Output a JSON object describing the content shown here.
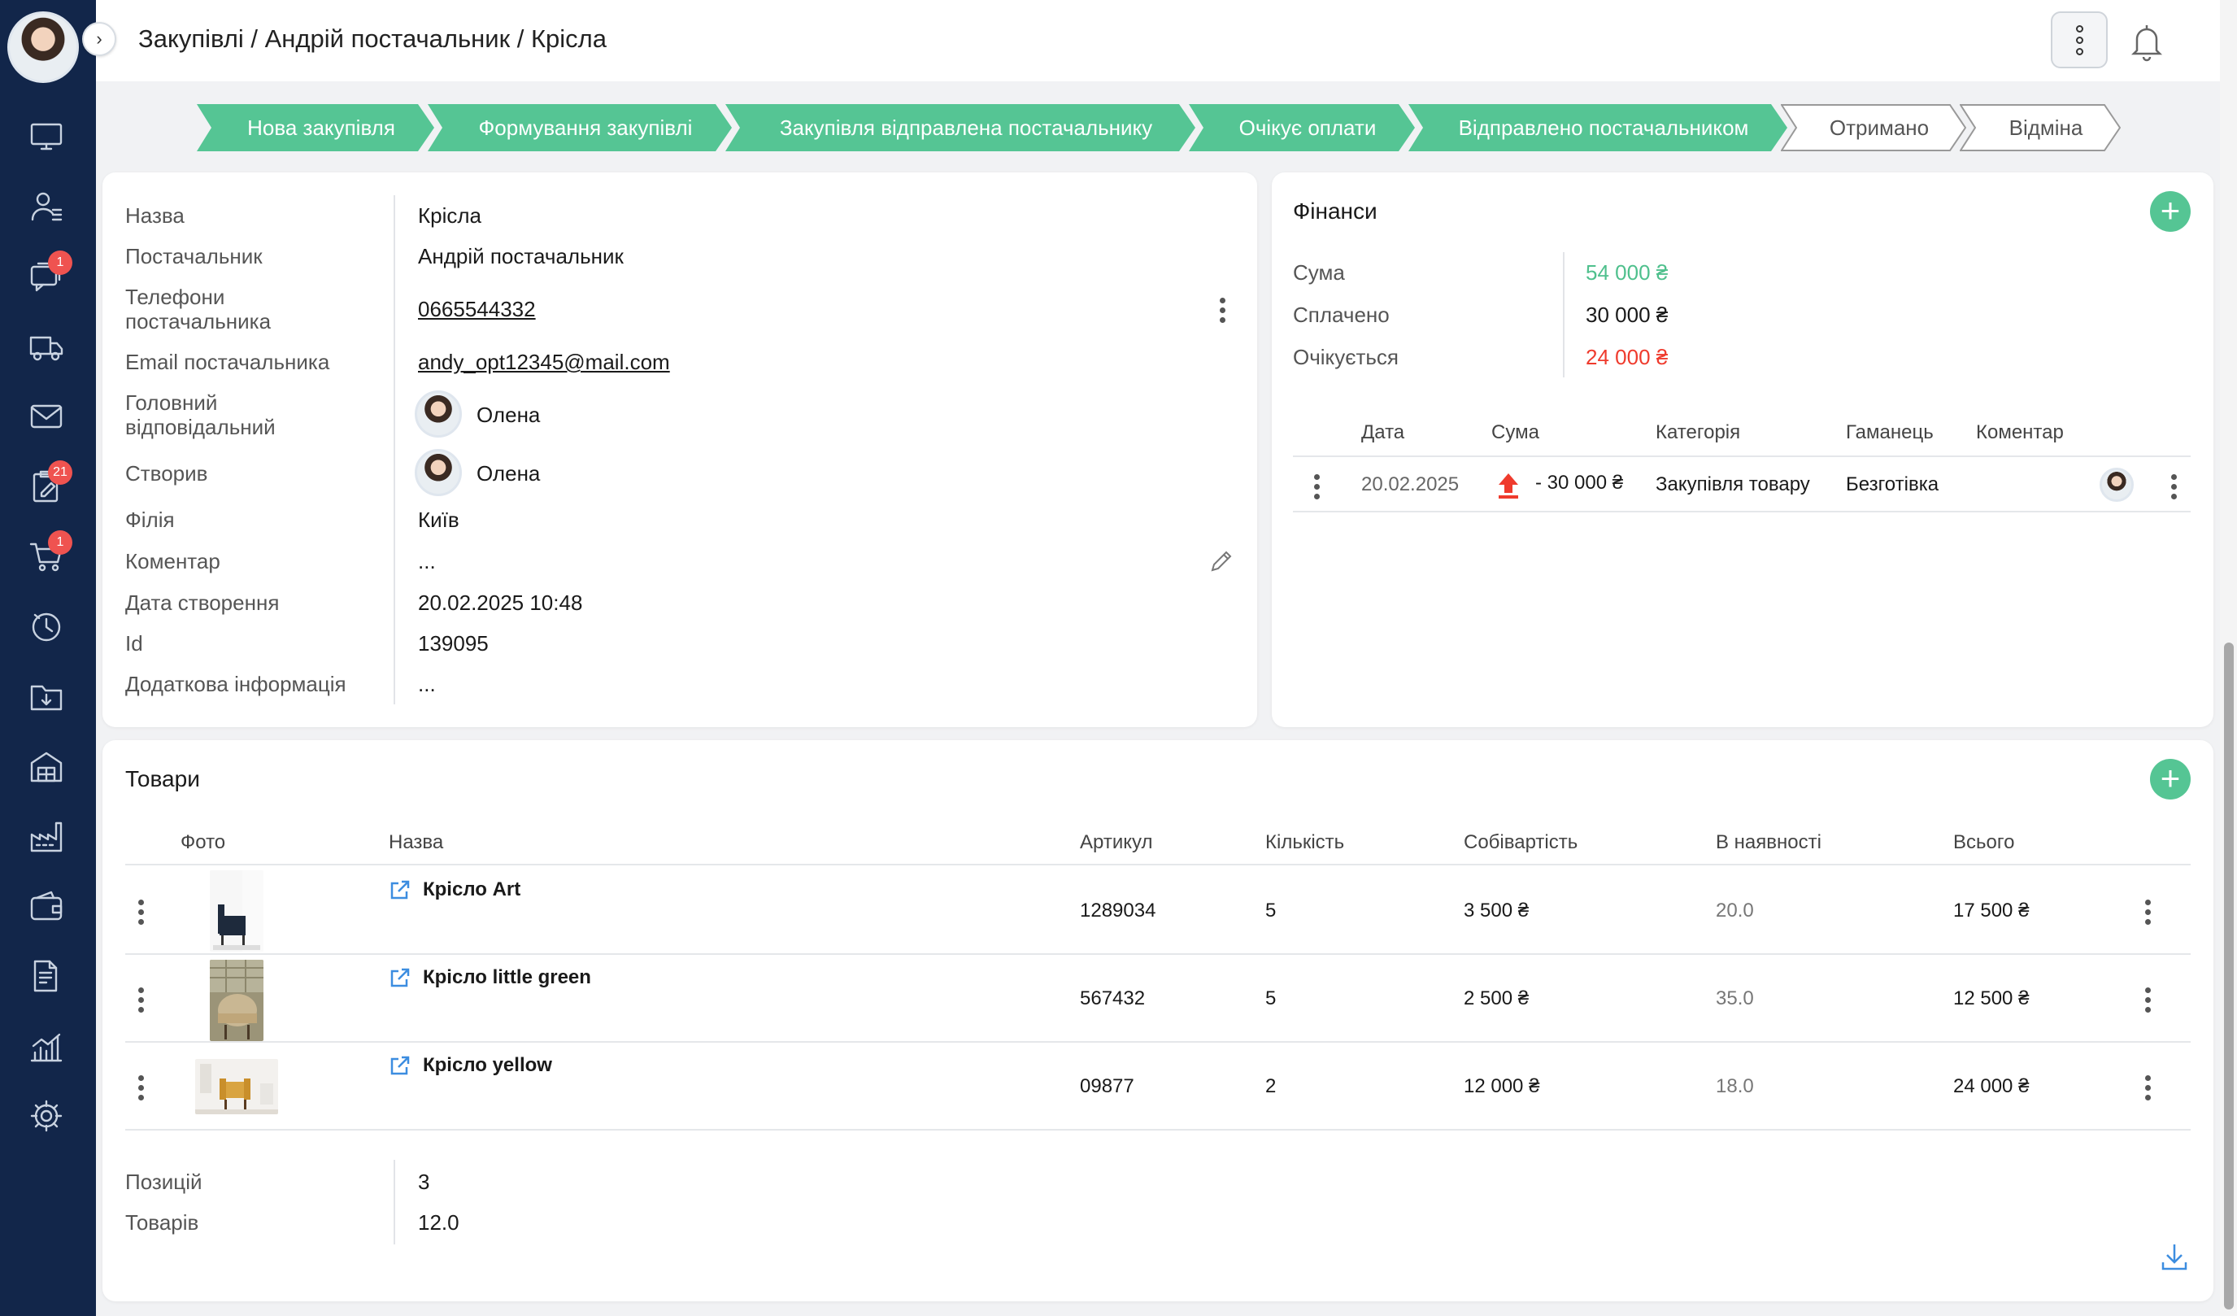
{
  "breadcrumb": "Закупівлі / Андрій постачальник / Крісла",
  "nav": {
    "badges": {
      "chat": "1",
      "tasks": "21",
      "cart": "1"
    }
  },
  "stepper": [
    {
      "label": "Нова закупівля",
      "done": true
    },
    {
      "label": "Формування закупівлі",
      "done": true
    },
    {
      "label": "Закупівля відправлена постачальнику",
      "done": true
    },
    {
      "label": "Очікує оплати",
      "done": true
    },
    {
      "label": "Відправлено постачальником",
      "done": true
    },
    {
      "label": "Отримано",
      "done": false
    },
    {
      "label": "Відміна",
      "done": false
    }
  ],
  "info": {
    "name_label": "Назва",
    "name": "Крісла",
    "supplier_label": "Постачальник",
    "supplier": "Андрій постачальник",
    "phones_label": "Телефони постачальника",
    "phone": "0665544332",
    "email_label": "Email постачальника",
    "email": "andy_opt12345@mail.com",
    "responsible_label": "Головний відповідальний",
    "responsible": "Олена",
    "created_by_label": "Створив",
    "created_by": "Олена",
    "branch_label": "Філія",
    "branch": "Київ",
    "comment_label": "Коментар",
    "comment": "...",
    "created_date_label": "Дата створення",
    "created_date": "20.02.2025 10:48",
    "id_label": "Id",
    "id": "139095",
    "extra_label": "Додаткова інформація",
    "extra": "..."
  },
  "finance": {
    "title": "Фінанси",
    "sum_label": "Сума",
    "sum": "54 000 ₴",
    "paid_label": "Сплачено",
    "paid": "30 000 ₴",
    "expected_label": "Очікується",
    "expected": "24 000 ₴",
    "columns": {
      "date": "Дата",
      "sum": "Сума",
      "category": "Категорія",
      "wallet": "Гаманець",
      "comment": "Коментар"
    },
    "rows": [
      {
        "date": "20.02.2025",
        "sum": "- 30 000 ₴",
        "category": "Закупівля товару",
        "wallet": "Безготівка"
      }
    ],
    "colors": {
      "sum": "#4fc08d",
      "expected": "#ef3b2d"
    }
  },
  "products": {
    "title": "Товари",
    "columns": {
      "photo": "Фото",
      "name": "Назва",
      "sku": "Артикул",
      "qty": "Кількість",
      "cost": "Собівартість",
      "stock": "В наявності",
      "total": "Всього"
    },
    "rows": [
      {
        "name": "Крісло Art",
        "sku": "1289034",
        "qty": "5",
        "cost": "3 500 ₴",
        "stock": "20.0",
        "total": "17 500 ₴"
      },
      {
        "name": "Крісло little green",
        "sku": "567432",
        "qty": "5",
        "cost": "2 500 ₴",
        "stock": "35.0",
        "total": "12 500 ₴"
      },
      {
        "name": "Крісло yellow",
        "sku": "09877",
        "qty": "2",
        "cost": "12 000 ₴",
        "stock": "18.0",
        "total": "24 000 ₴"
      }
    ],
    "positions_label": "Позицій",
    "positions": "3",
    "goods_label": "Товарів",
    "goods": "12.0"
  },
  "colors": {
    "sidebar": "#12264a",
    "accent": "#55c594",
    "step_done": "#55c594"
  }
}
